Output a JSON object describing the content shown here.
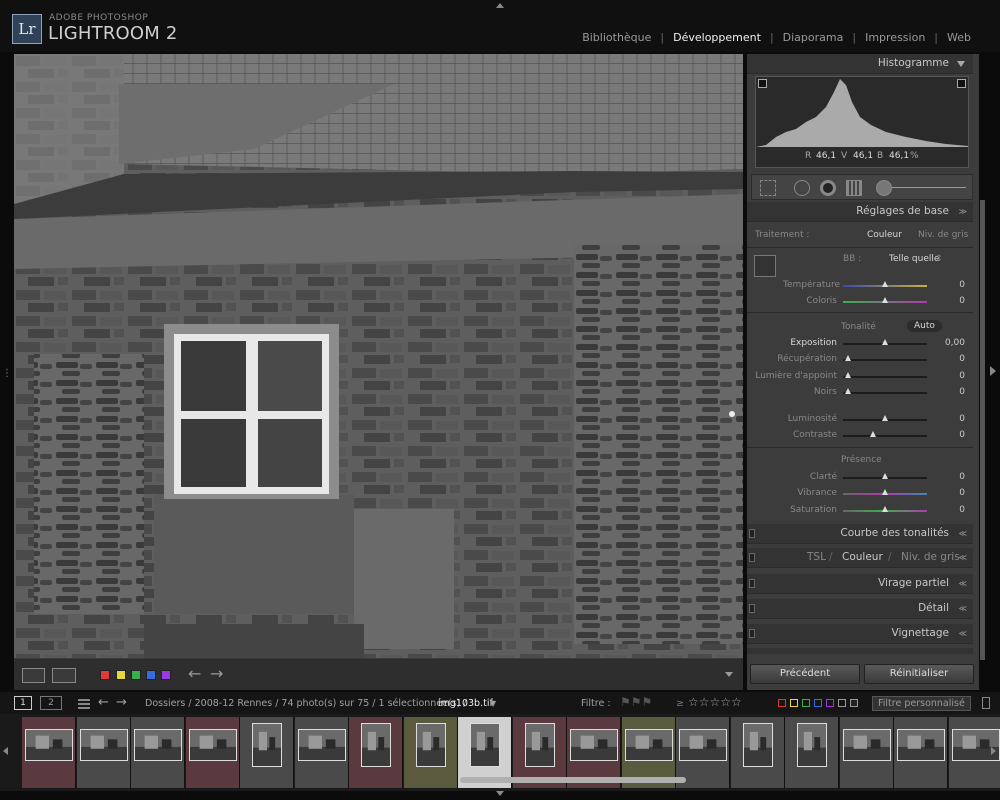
{
  "app": {
    "logo": "Lr",
    "vendor": "ADOBE PHOTOSHOP",
    "name": "LIGHTROOM 2"
  },
  "modules": [
    {
      "label": "Bibliothèque",
      "active": false
    },
    {
      "label": "Développement",
      "active": true
    },
    {
      "label": "Diaporama",
      "active": false
    },
    {
      "label": "Impression",
      "active": false
    },
    {
      "label": "Web",
      "active": false
    }
  ],
  "module_separator": "|",
  "histogram": {
    "title": "Histogramme",
    "r_label": "R",
    "r_value": "46,1",
    "v_label": "V",
    "v_value": "46,1",
    "b_label": "B",
    "b_value": "46,1",
    "unit": "%"
  },
  "basic": {
    "title": "Réglages de base",
    "treatment_label": "Traitement :",
    "treatment_color": "Couleur",
    "treatment_gray": "Niv. de gris",
    "wb_label": "BB :",
    "wb_value": "Telle quelle",
    "temp_label": "Température",
    "temp_value": "0",
    "tint_label": "Coloris",
    "tint_value": "0",
    "tone_label": "Tonalité",
    "auto_label": "Auto",
    "exposure_label": "Exposition",
    "exposure_value": "0,00",
    "recovery_label": "Récupération",
    "recovery_value": "0",
    "fill_label": "Lumière d'appoint",
    "fill_value": "0",
    "blacks_label": "Noirs",
    "blacks_value": "0",
    "brightness_label": "Luminosité",
    "brightness_value": "0",
    "contrast_label": "Contraste",
    "contrast_value": "0",
    "presence_label": "Présence",
    "clarity_label": "Clarté",
    "clarity_value": "0",
    "vibrance_label": "Vibrance",
    "vibrance_value": "0",
    "saturation_label": "Saturation",
    "saturation_value": "0"
  },
  "panels": {
    "tone_curve": "Courbe des tonalités",
    "hsl_tsl": "TSL",
    "hsl_color": "Couleur",
    "hsl_gray": "Niv. de gris",
    "split": "Virage partiel",
    "detail": "Détail",
    "vignette": "Vignettage"
  },
  "buttons": {
    "previous": "Précédent",
    "reset": "Réinitialiser"
  },
  "filmstrip_bar": {
    "page1": "1",
    "page2": "2",
    "path": "Dossiers / 2008-12 Rennes / 74 photo(s) sur 75 / 1 sélectionnée(s) /",
    "filename": "img103b.tif",
    "filter_label": "Filtre :",
    "filter_preset": "Filtre personnalisé"
  },
  "colors": {
    "swatch_red": "#e03a3a",
    "swatch_yellow": "#e5d83a",
    "swatch_green": "#3ab04a",
    "swatch_blue": "#3a6ae0",
    "swatch_purple": "#9a3ae0",
    "cell_red": "#5a3a3e",
    "cell_olive": "#5a5a3e",
    "cell_gray": "#4a4a4a",
    "cell_selected": "#d0d0d0"
  },
  "toolbar": {
    "view_icon": "loupe-view-icon",
    "compare_icon": "compare-view-icon"
  }
}
